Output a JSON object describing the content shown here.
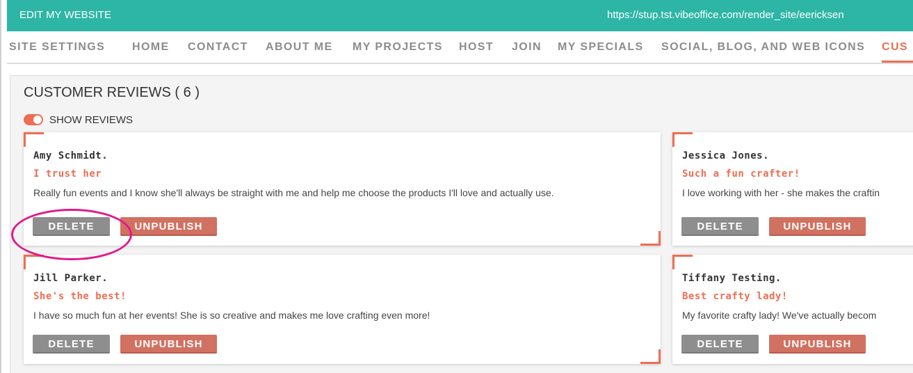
{
  "topbar": {
    "title": "EDIT MY WEBSITE",
    "url": "https://stup.tst.vibeoffice.com/render_site/eericksen"
  },
  "nav": {
    "items": [
      "SITE SETTINGS",
      "HOME",
      "CONTACT",
      "ABOUT ME",
      "MY PROJECTS",
      "HOST",
      "JOIN",
      "MY SPECIALS",
      "SOCIAL, BLOG, AND WEB ICONS",
      "CUS"
    ],
    "active_index": 9
  },
  "reviews": {
    "heading": "CUSTOMER REVIEWS ( 6 )",
    "show_label": "SHOW REVIEWS",
    "show_enabled": true,
    "cards": [
      {
        "name": "Amy Schmidt.",
        "title": "I trust her",
        "text": "Really fun events and I know she'll always be straight with me and help me choose the products I'll love and actually use.",
        "delete_label": "DELETE",
        "unpublish_label": "UNPUBLISH"
      },
      {
        "name": "Jessica Jones.",
        "title": "Such a fun crafter!",
        "text": "I love working with her - she makes the craftin",
        "delete_label": "DELETE",
        "unpublish_label": "UNPUBLISH"
      },
      {
        "name": "Jill Parker.",
        "title": "She's the best!",
        "text": "I have so much fun at her events! She is so creative and makes me love crafting even more!",
        "delete_label": "DELETE",
        "unpublish_label": "UNPUBLISH"
      },
      {
        "name": "Tiffany Testing.",
        "title": "Best crafty lady!",
        "text": "My favorite crafty lady! We've actually becom",
        "delete_label": "DELETE",
        "unpublish_label": "UNPUBLISH"
      }
    ]
  },
  "colors": {
    "topbar": "#2db5a6",
    "accent": "#ec6f52",
    "delete_button": "#8e8e8e",
    "unpublish_button": "#d17161",
    "highlight_annotation": "#e0198a"
  }
}
